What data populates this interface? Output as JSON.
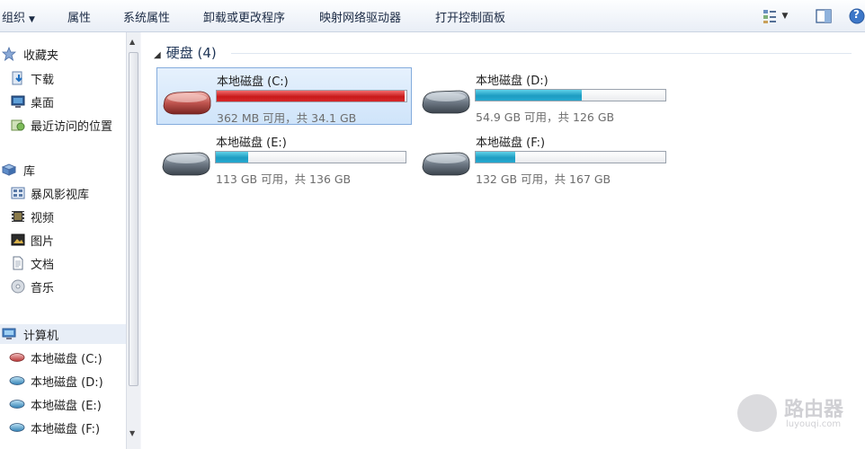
{
  "toolbar": {
    "organize": "组织",
    "properties": "属性",
    "system_properties": "系统属性",
    "uninstall": "卸载或更改程序",
    "map_drive": "映射网络驱动器",
    "control_panel": "打开控制面板",
    "help": "?"
  },
  "sidebar": {
    "favorites": "收藏夹",
    "downloads": "下载",
    "desktop": "桌面",
    "recent": "最近访问的位置",
    "libraries": "库",
    "storm": "暴风影视库",
    "videos": "视频",
    "pictures": "图片",
    "documents": "文档",
    "music": "音乐",
    "computer": "计算机",
    "drive_c": "本地磁盘 (C:)",
    "drive_d": "本地磁盘 (D:)",
    "drive_e": "本地磁盘 (E:)",
    "drive_f": "本地磁盘 (F:)"
  },
  "main": {
    "group_title": "硬盘 (4)",
    "drives": [
      {
        "name": "本地磁盘 (C:)",
        "free_text": "362 MB 可用，共 34.1 GB",
        "used_fraction": 0.99,
        "bar_color": "#c81a1a"
      },
      {
        "name": "本地磁盘 (D:)",
        "free_text": "54.9 GB 可用，共 126 GB",
        "used_fraction": 0.56,
        "bar_color": "#1d9cc2"
      },
      {
        "name": "本地磁盘 (E:)",
        "free_text": "113 GB 可用，共 136 GB",
        "used_fraction": 0.17,
        "bar_color": "#1d9cc2"
      },
      {
        "name": "本地磁盘 (F:)",
        "free_text": "132 GB 可用，共 167 GB",
        "used_fraction": 0.21,
        "bar_color": "#1d9cc2"
      }
    ]
  },
  "watermark": {
    "title": "路由器",
    "url": "luyouqi.com"
  },
  "icons": {
    "star": "star-icon",
    "download": "download-icon",
    "desktop": "desktop-icon",
    "recent": "recent-places-icon",
    "library": "library-icon",
    "computer": "computer-icon",
    "drive": "hard-drive-icon"
  }
}
